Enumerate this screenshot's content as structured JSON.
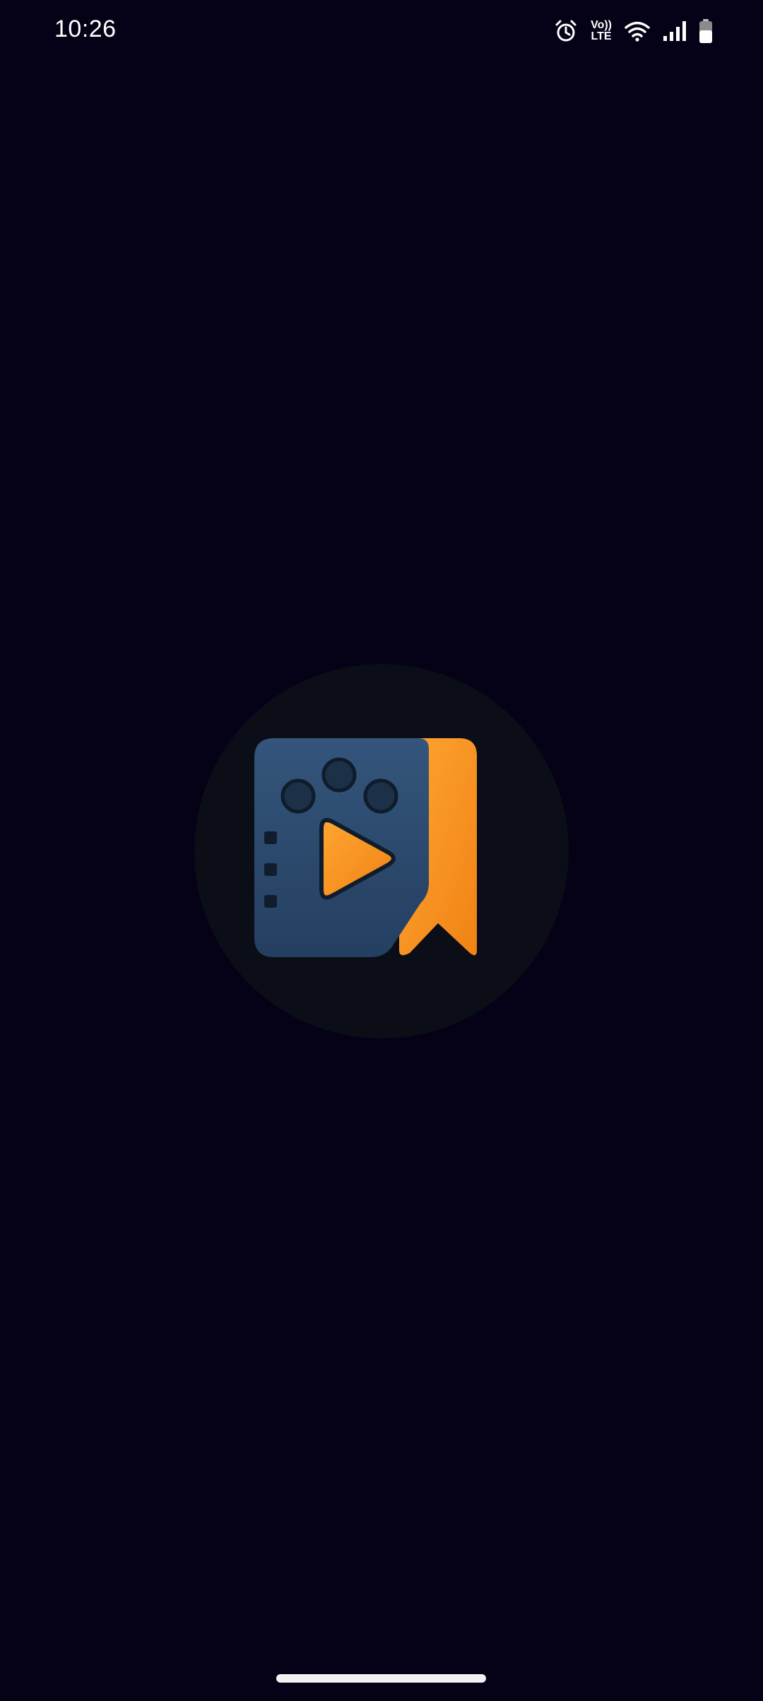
{
  "status_bar": {
    "time": "10:26",
    "icons": [
      "alarm-icon",
      "volte-icon",
      "wifi-icon",
      "signal-icon",
      "battery-icon"
    ],
    "volte_label_top": "Vo))",
    "volte_label_bottom": "LTE"
  },
  "splash": {
    "logo": "video-bookmark-app-logo",
    "colors": {
      "background": "#050217",
      "circle": "#0b0d17",
      "film_blue": "#2c4a6e",
      "bookmark_orange": "#f7921e"
    }
  },
  "navigation": {
    "gesture_handle": "home-gesture-bar"
  }
}
